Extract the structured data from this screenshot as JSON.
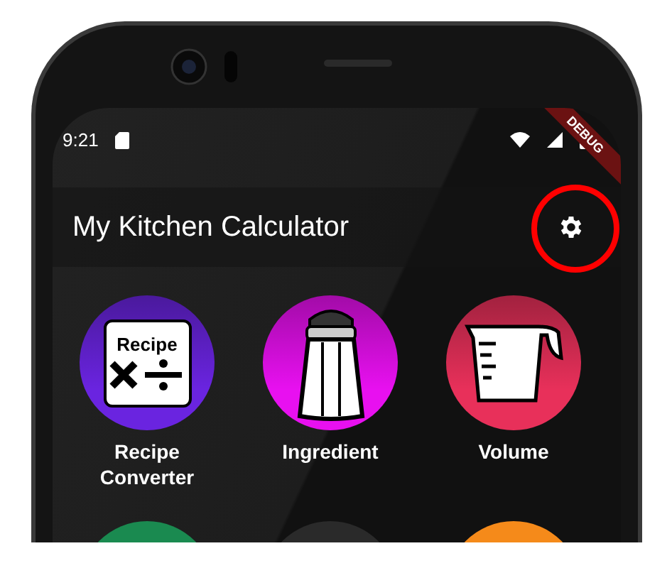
{
  "status_bar": {
    "time": "9:21"
  },
  "debug_banner": "DEBUG",
  "app_bar": {
    "title": "My Kitchen Calculator",
    "highlighted_settings": true
  },
  "tiles": [
    {
      "kind": "recipe",
      "label": "Recipe Converter",
      "icon_text": "Recipe",
      "color": "#6a24e0"
    },
    {
      "kind": "shaker",
      "label": "Ingredient",
      "color": "#e810f0"
    },
    {
      "kind": "cup",
      "label": "Volume",
      "color": "#e8305a"
    },
    {
      "kind": "plain",
      "color": "#1a8a50"
    },
    {
      "kind": "plain",
      "color": "#2a2a2a"
    },
    {
      "kind": "plain",
      "color": "#f58a1a"
    }
  ]
}
